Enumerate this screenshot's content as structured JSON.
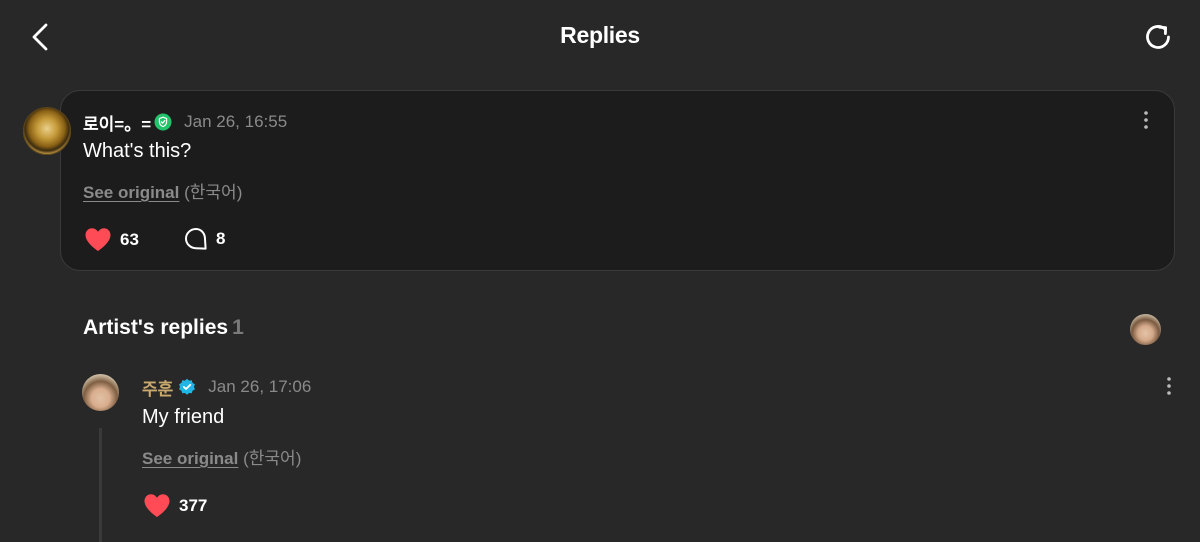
{
  "header": {
    "title": "Replies"
  },
  "comment": {
    "author": "로이=。=",
    "timestamp": "Jan 26, 16:55",
    "text": "What's this?",
    "see_original": "See original",
    "language": "(한국어)",
    "likes": "63",
    "replies": "8"
  },
  "artist_replies": {
    "title": "Artist's replies",
    "count": "1",
    "items": [
      {
        "author": "주훈",
        "timestamp": "Jan 26, 17:06",
        "text": "My friend",
        "see_original": "See original",
        "language": "(한국어)",
        "likes": "377"
      }
    ]
  },
  "colors": {
    "background": "#282828",
    "card": "#1c1c1c",
    "like": "#ff4b55",
    "verified_green": "#22c36b",
    "verified_blue": "#1fb6e6",
    "artist_name": "#c9a96e",
    "muted": "#8a8a8a"
  },
  "icons": [
    "back-icon",
    "refresh-icon",
    "verified-icon",
    "more-icon",
    "heart-icon",
    "comment-icon"
  ]
}
